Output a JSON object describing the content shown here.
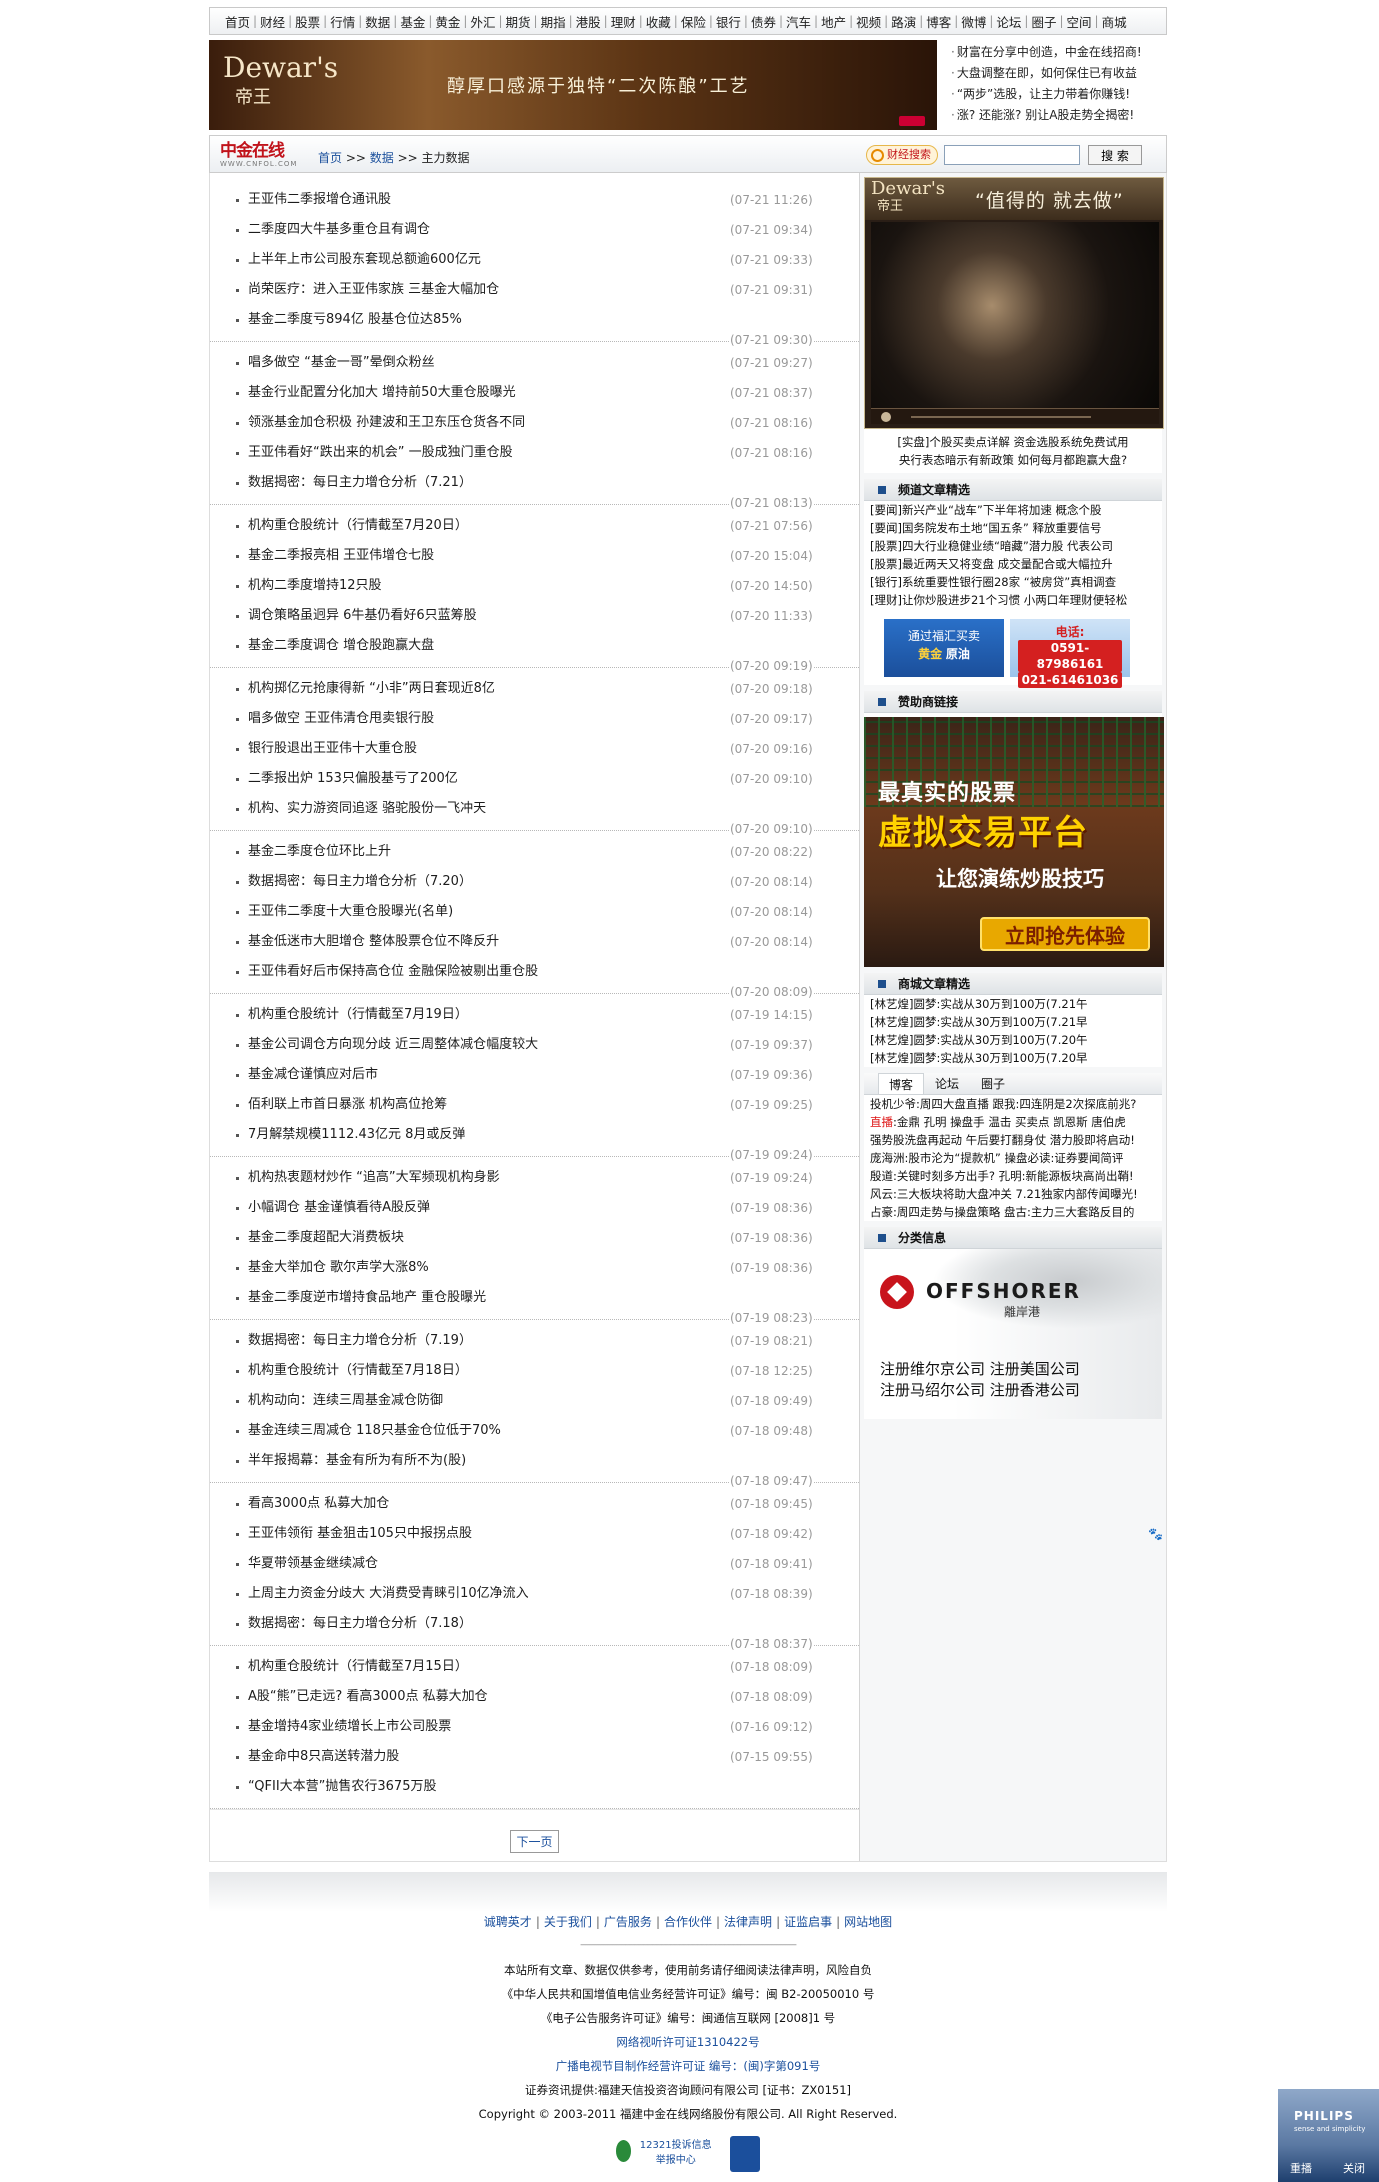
{
  "topnav": [
    "首页",
    "财经",
    "股票",
    "行情",
    "数据",
    "基金",
    "黄金",
    "外汇",
    "期货",
    "期指",
    "港股",
    "理财",
    "收藏",
    "保险",
    "银行",
    "债券",
    "汽车",
    "地产",
    "视频",
    "路演",
    "博客",
    "微博",
    "论坛",
    "圈子",
    "空间",
    "商城"
  ],
  "banner": {
    "brand": "Dewar's",
    "brand_cn": "帝王",
    "slogan": "醇厚口感源于独特“二次陈酿”工艺",
    "links": [
      "财富在分享中创造，中金在线招商!",
      "大盘调整在即，如何保住已有收益",
      "“两步”选股，让主力带着你赚钱!",
      "涨? 还能涨? 别让A股走势全揭密!"
    ]
  },
  "site_logo": {
    "cn": "中金在线",
    "en": "WWW.CNFOL.COM"
  },
  "breadcrumb": {
    "home": "首页",
    "sep1": " >> ",
    "data": "数据",
    "sep2": " >> ",
    "current": "主力数据"
  },
  "search": {
    "badge": "财经搜索",
    "button": "搜 索",
    "value": ""
  },
  "groups": [
    {
      "items": [
        {
          "title": "王亚伟二季报增仓通讯股",
          "date": "(07-21 11:26)"
        },
        {
          "title": "二季度四大牛基多重仓且有调仓",
          "date": "(07-21 09:34)"
        },
        {
          "title": "上半年上市公司股东套现总额逾600亿元",
          "date": "(07-21 09:33)"
        },
        {
          "title": "尚荣医疗：进入王亚伟家族 三基金大幅加仓",
          "date": "(07-21 09:31)"
        },
        {
          "title": "基金二季度亏894亿 股基仓位达85%",
          "date": "(07-21 09:30)"
        }
      ]
    },
    {
      "items": [
        {
          "title": "唱多做空 “基金一哥”晕倒众粉丝",
          "date": "(07-21 09:27)"
        },
        {
          "title": "基金行业配置分化加大 增持前50大重仓股曝光",
          "date": "(07-21 08:37)"
        },
        {
          "title": "领涨基金加仓积极 孙建波和王卫东压仓货各不同",
          "date": "(07-21 08:16)"
        },
        {
          "title": "王亚伟看好“跌出来的机会” 一股成独门重仓股",
          "date": "(07-21 08:16)"
        },
        {
          "title": "数据揭密：每日主力增仓分析（7.21）",
          "date": "(07-21 08:13)"
        }
      ]
    },
    {
      "items": [
        {
          "title": "机构重仓股统计（行情截至7月20日）",
          "date": "(07-21 07:56)"
        },
        {
          "title": "基金二季报亮相 王亚伟增仓七股",
          "date": "(07-20 15:04)"
        },
        {
          "title": "机构二季度增持12只股",
          "date": "(07-20 14:50)"
        },
        {
          "title": "调仓策略虽迥异 6牛基仍看好6只蓝筹股",
          "date": "(07-20 11:33)"
        },
        {
          "title": "基金二季度调仓 增仓股跑赢大盘",
          "date": "(07-20 09:19)"
        }
      ]
    },
    {
      "items": [
        {
          "title": "机构掷亿元抢康得新 “小非”两日套现近8亿",
          "date": "(07-20 09:18)"
        },
        {
          "title": "唱多做空 王亚伟清仓甩卖银行股",
          "date": "(07-20 09:17)"
        },
        {
          "title": "银行股退出王亚伟十大重仓股",
          "date": "(07-20 09:16)"
        },
        {
          "title": "二季报出炉 153只偏股基亏了200亿",
          "date": "(07-20 09:10)"
        },
        {
          "title": "机构、实力游资同追逐 骆驼股份一飞冲天",
          "date": "(07-20 09:10)"
        }
      ]
    },
    {
      "items": [
        {
          "title": "基金二季度仓位环比上升",
          "date": "(07-20 08:22)"
        },
        {
          "title": "数据揭密：每日主力增仓分析（7.20）",
          "date": "(07-20 08:14)"
        },
        {
          "title": "王亚伟二季度十大重仓股曝光(名单)",
          "date": "(07-20 08:14)"
        },
        {
          "title": "基金低迷市大胆增仓 整体股票仓位不降反升",
          "date": "(07-20 08:14)"
        },
        {
          "title": "王亚伟看好后市保持高仓位 金融保险被剔出重仓股",
          "date": "(07-20 08:09)"
        }
      ]
    },
    {
      "items": [
        {
          "title": "机构重仓股统计（行情截至7月19日）",
          "date": "(07-19 14:15)"
        },
        {
          "title": "基金公司调仓方向现分歧 近三周整体减仓幅度较大",
          "date": "(07-19 09:37)"
        },
        {
          "title": "基金减仓谨慎应对后市",
          "date": "(07-19 09:36)"
        },
        {
          "title": "佰利联上市首日暴涨 机构高位抢筹",
          "date": "(07-19 09:25)"
        },
        {
          "title": "7月解禁规模1112.43亿元 8月或反弹",
          "date": "(07-19 09:24)"
        }
      ]
    },
    {
      "items": [
        {
          "title": "机构热衷题材炒作 “追高”大军频现机构身影",
          "date": "(07-19 09:24)"
        },
        {
          "title": "小幅调仓 基金谨慎看待A股反弹",
          "date": "(07-19 08:36)"
        },
        {
          "title": "基金二季度超配大消费板块",
          "date": "(07-19 08:36)"
        },
        {
          "title": "基金大举加仓 歌尔声学大涨8%",
          "date": "(07-19 08:36)"
        },
        {
          "title": "基金二季度逆市增持食品地产 重仓股曝光",
          "date": "(07-19 08:23)"
        }
      ]
    },
    {
      "items": [
        {
          "title": "数据揭密：每日主力增仓分析（7.19）",
          "date": "(07-19 08:21)"
        },
        {
          "title": "机构重仓股统计（行情截至7月18日）",
          "date": "(07-18 12:25)"
        },
        {
          "title": "机构动向：连续三周基金减仓防御",
          "date": "(07-18 09:49)"
        },
        {
          "title": "基金连续三周减仓 118只基金仓位低于70%",
          "date": "(07-18 09:48)"
        },
        {
          "title": "半年报揭幕：基金有所为有所不为(股)",
          "date": "(07-18 09:47)"
        }
      ]
    },
    {
      "items": [
        {
          "title": "看高3000点 私募大加仓",
          "date": "(07-18 09:45)"
        },
        {
          "title": "王亚伟领衔 基金狙击105只中报拐点股",
          "date": "(07-18 09:42)"
        },
        {
          "title": "华夏带领基金继续减仓",
          "date": "(07-18 09:41)"
        },
        {
          "title": "上周主力资金分歧大 大消费受青睐引10亿净流入",
          "date": "(07-18 08:39)"
        },
        {
          "title": "数据揭密：每日主力增仓分析（7.18）",
          "date": "(07-18 08:37)"
        }
      ]
    },
    {
      "items": [
        {
          "title": "机构重仓股统计（行情截至7月15日）",
          "date": "(07-18 08:09)"
        },
        {
          "title": "A股“熊”已走远? 看高3000点 私募大加仓",
          "date": "(07-18 08:09)"
        },
        {
          "title": "基金增持4家业绩增长上市公司股票",
          "date": "(07-16 09:12)"
        },
        {
          "title": "基金命中8只高送转潜力股",
          "date": "(07-15 09:55)"
        },
        {
          "title": "“QFII大本营”抛售农行3675万股",
          "date": ""
        }
      ]
    }
  ],
  "pager": {
    "next": "下一页"
  },
  "side": {
    "video_ad": {
      "brand": "Dewar's",
      "brand_cn": "帝王",
      "quote": "“值得的 就去做”"
    },
    "dual_links": [
      "[实盘]个股买卖点详解 资金选股系统免费试用",
      "央行表态暗示有新政策 如何每月都跑赢大盘?"
    ],
    "channel_title": "频道文章精选",
    "channel_items": [
      "[要闻]新兴产业“战车”下半年将加速 概念个股",
      "[要闻]国务院发布土地“国五条” 释放重要信号",
      "[股票]四大行业稳健业绩“暗藏”潜力股 代表公司",
      "[股票]最近两天又将变盘 成交量配合或大幅拉升",
      "[银行]系统重要性银行圈28家 “被房贷”真相调查",
      "[理财]让你炒股进步21个习惯 小两口年理财便轻松"
    ],
    "promo_gold": {
      "line1": "通过福汇买卖",
      "gold": "黄金",
      "oil": "原油"
    },
    "promo_phone": {
      "label": "电话:",
      "phone1": "0591-87986161",
      "phone2": "021-61461036"
    },
    "sponsor_title": "赞助商链接",
    "sim_ad": {
      "l1": "最真实的股票",
      "l2": "虚拟交易平台",
      "l3": "让您演练炒股技巧",
      "cta": "立即抢先体验"
    },
    "mall_title": "商城文章精选",
    "mall_items": [
      "[林艺煌]圆梦:实战从30万到100万(7.21午",
      "[林艺煌]圆梦:实战从30万到100万(7.21早",
      "[林艺煌]圆梦:实战从30万到100万(7.20午",
      "[林艺煌]圆梦:实战从30万到100万(7.20早"
    ],
    "tabs": [
      "博客",
      "论坛",
      "圈子"
    ],
    "blog_items": [
      {
        "pre": "",
        "hl": "",
        "text": "投机少爷:周四大盘直播 跟我:四连阴是2次探底前兆?"
      },
      {
        "pre": "",
        "hl": "直播",
        "text": ":金鼎 孔明 操盘手 温击 买卖点 凯恩斯 唐伯虎"
      },
      {
        "pre": "",
        "hl": "",
        "text": "强势股洗盘再起动 午后要打翻身仗 潜力股即将启动!"
      },
      {
        "pre": "",
        "hl": "",
        "text": "庞海洲:股市沦为“提款机” 操盘必读:证券要闻简评"
      },
      {
        "pre": "",
        "hl": "",
        "text": "殷道:关键时刻多方出手? 孔明:新能源板块高尚出鞘!"
      },
      {
        "pre": "",
        "hl": "",
        "text": "风云:三大板块将助大盘冲关 7.21独家内部传闻曝光!"
      },
      {
        "pre": "",
        "hl": "",
        "text": "占豪:周四走势与操盘策略 盘古:主力三大套路反目的"
      }
    ],
    "classified_title": "分类信息",
    "offshore": {
      "name": "OFFSHORER",
      "sub": "離岸港",
      "reg1": "注册维尔京公司 注册美国公司",
      "reg2": "注册马绍尔公司 注册香港公司"
    }
  },
  "footer": {
    "links": [
      "诚聘英才",
      "关于我们",
      "广告服务",
      "合作伙伴",
      "法律声明",
      "证监启事",
      "网站地图"
    ],
    "rule": "------------------------------------------------------------------------------------------------",
    "lines": [
      "本站所有文章、数据仅供参考，使用前务请仔细阅读法律声明，风险自负",
      "《中华人民共和国增值电信业务经营许可证》编号：闽 B2-20050010 号",
      "《电子公告服务许可证》编号：闽通信互联网 [2008]1 号",
      "网络视听许可证1310422号",
      "广播电视节目制作经营许可证 编号：(闽)字第091号",
      "证券资讯提供:福建天信投资咨询顾问有限公司 [证书：ZX0151]",
      "Copyright © 2003-2011 福建中金在线网络股份有限公司. All Right Reserved."
    ],
    "badge_text": "12321投诉信息 举报中心"
  },
  "philips": {
    "name": "PHILIPS",
    "tag": "sense and simplicity",
    "replay": "重播",
    "close": "关闭"
  }
}
